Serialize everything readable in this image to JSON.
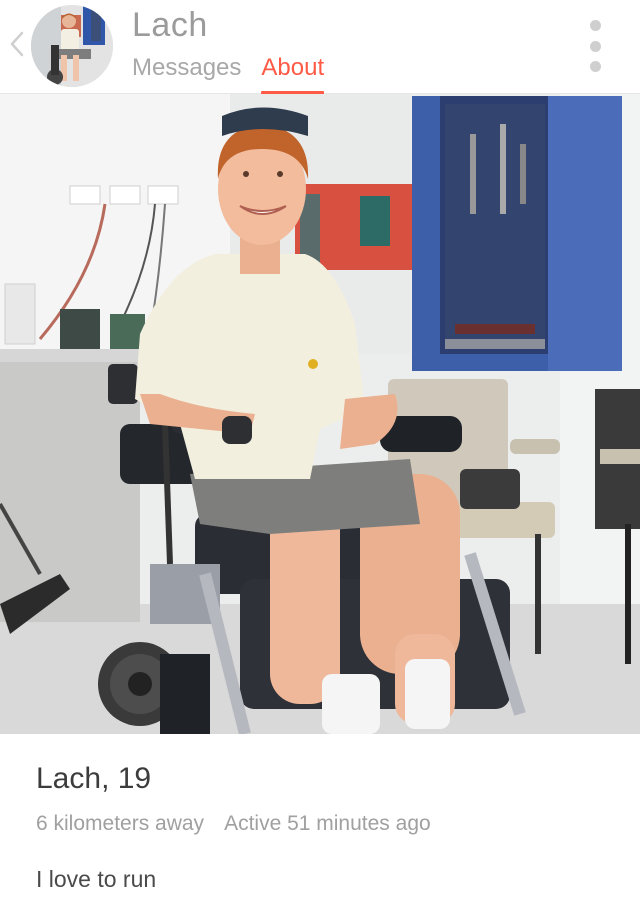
{
  "header": {
    "name": "Lach",
    "tabs": [
      {
        "label": "Messages",
        "active": false
      },
      {
        "label": "About",
        "active": true
      }
    ]
  },
  "profile": {
    "name": "Lach",
    "age": "19",
    "distance": "6 kilometers away",
    "activity": "Active 51 minutes ago",
    "bio": "I love to run"
  },
  "colors": {
    "accent": "#fe5a46",
    "muted_text": "#a0a0a0"
  },
  "icons": {
    "back": "chevron-left-icon",
    "more": "kebab-menu-icon"
  }
}
